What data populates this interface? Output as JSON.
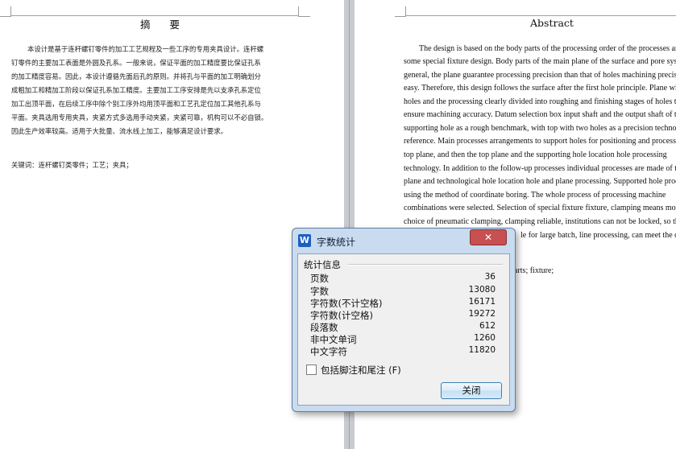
{
  "left_page": {
    "title": "摘  要",
    "body_lines": [
      "本设计是基于连杆螺钉零件的加工工艺规程及一些工序的专用夹具设计。连杆螺",
      "钉零件的主要加工表面是外圆及孔系。一般来说，保证平面的加工精度要比保证孔系",
      "的加工精度容易。因此，本设计遵循先面后孔的原则。并将孔与平面的加工明确划分",
      "成粗加工和精加工阶段以保证孔系加工精度。主要加工工序安排是先以支承孔系定位",
      "加工出顶平面，在后续工序中除个别工序外均用顶平面和工艺孔定位加工其他孔系与",
      "平面。夹具选用专用夹具，夹紧方式多选用手动夹紧，夹紧可靠，机构可以不必自锁。",
      "因此生产效率较高。适用于大批量、流水线上加工，能够满足设计要求。"
    ],
    "keywords": "关键词：连杆螺钉类零件；工艺；夹具；"
  },
  "right_page": {
    "title": "Abstract",
    "body_lines": [
      "The design is based on the body parts of the processing order of the processes and",
      "some special fixture design. Body parts of the main plane of the surface and pore system",
      "general, the plane guarantee processing precision than that of holes machining precision",
      "easy. Therefore, this design follows the surface after the first hole principle. Plane with",
      "holes and the processing clearly divided into roughing and finishing stages of holes to",
      "ensure machining accuracy. Datum selection box input shaft and the output shaft of the",
      "supporting hole as a rough benchmark, with top with two holes as a precision technology",
      "reference. Main processes arrangements to support holes for positioning and processing",
      "top plane, and then the top plane and the supporting hole location hole processing",
      "technology. In addition to the follow-up processes individual processes are made of the top",
      "plane and technological hole location hole and plane processing. Supported hole process",
      "using the method of coordinate boring. The whole process of processing machine",
      "combinations were selected. Selection of special fixture fixture, clamping means more",
      "choice of pneumatic clamping, clamping reliable, institutions can not be locked, so the",
      "le for large batch, line processing, can meet the design"
    ],
    "keywords_fragment": "arts; fixture;"
  },
  "dialog": {
    "title": "字数统计",
    "app_icon": "W",
    "close_icon_glyph": "✕",
    "group_title": "统计信息",
    "stats": [
      {
        "label": "页数",
        "value": "36"
      },
      {
        "label": "字数",
        "value": "13080"
      },
      {
        "label": "字符数(不计空格)",
        "value": "16171"
      },
      {
        "label": "字符数(计空格)",
        "value": "19272"
      },
      {
        "label": "段落数",
        "value": "612"
      },
      {
        "label": "非中文单词",
        "value": "1260"
      },
      {
        "label": "中文字符",
        "value": "11820"
      }
    ],
    "footnote_checkbox_label": "包括脚注和尾注 (F)",
    "footnote_checked": false,
    "close_button_label": "关闭"
  }
}
